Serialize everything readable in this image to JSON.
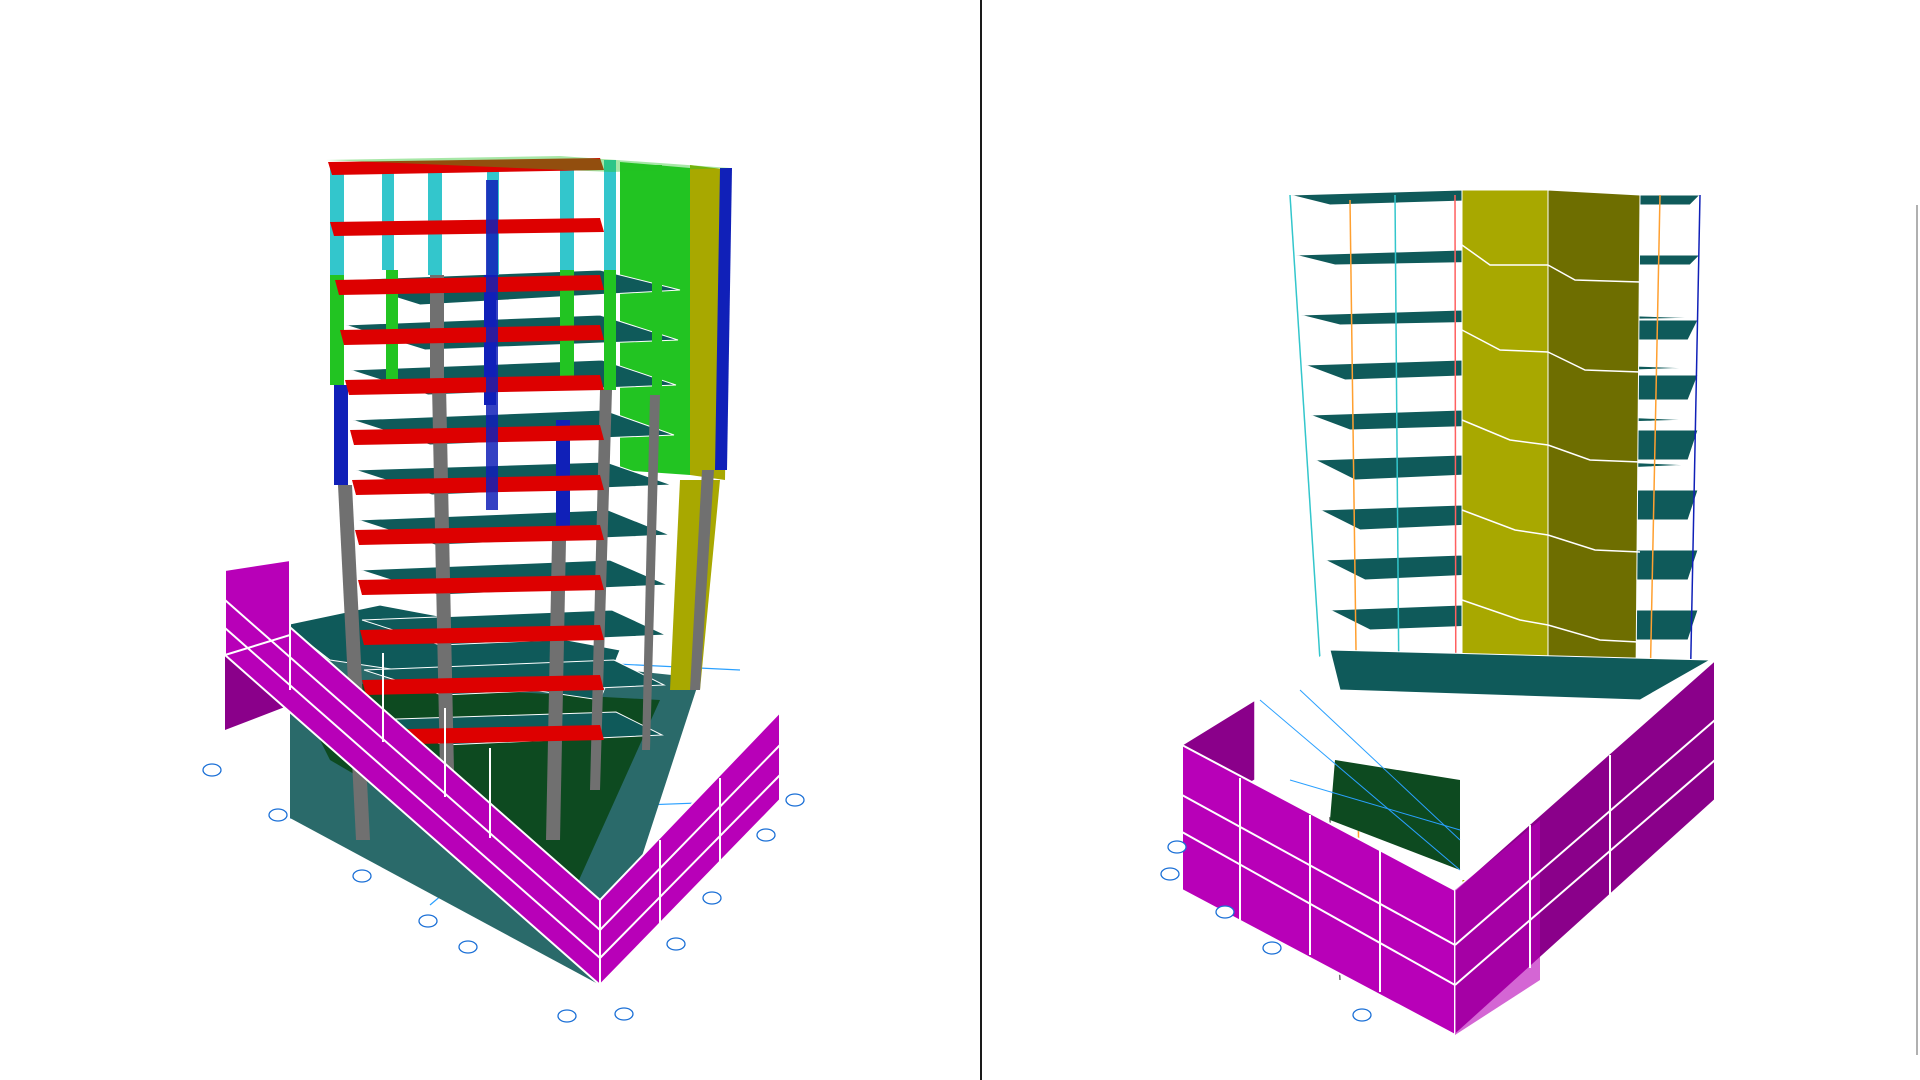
{
  "views": [
    {
      "id": "left",
      "name": "3d-view-left"
    },
    {
      "id": "right",
      "name": "3d-view-right"
    }
  ],
  "colors": {
    "background": "#ffffff",
    "retaining_wall": "#b800b8",
    "retaining_wall_dark": "#8a008a",
    "slab": "#0f5a5a",
    "beam": "#dd0000",
    "column_cyan": "#33c6cc",
    "column_green": "#22c422",
    "column_blue": "#1020b8",
    "column_gray": "#707070",
    "core_wall": "#a8a800",
    "core_wall_dark": "#6e6e00",
    "grid_line": "#2aa0ff"
  },
  "icons": [
    "grid-bubble-icon"
  ]
}
